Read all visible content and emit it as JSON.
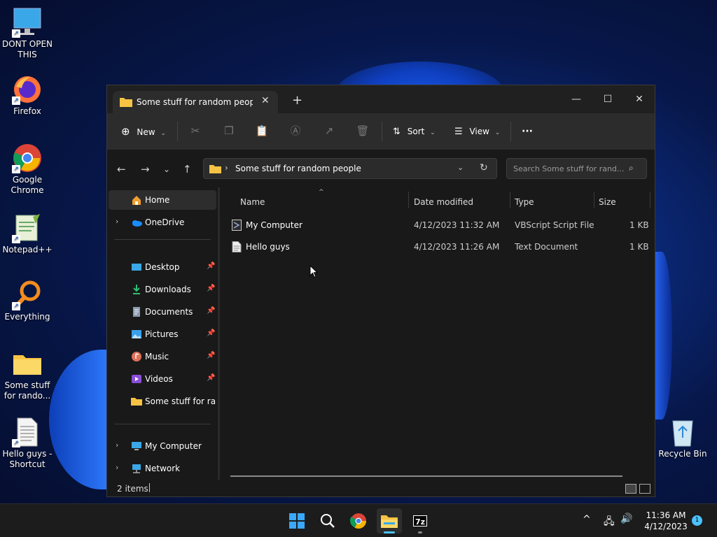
{
  "desktop": {
    "icons": [
      {
        "label": "DONT OPEN THIS",
        "icon": "monitor-icon"
      },
      {
        "label": "Firefox",
        "icon": "firefox-icon"
      },
      {
        "label": "Google Chrome",
        "icon": "chrome-icon"
      },
      {
        "label": "Notepad++",
        "icon": "notepadpp-icon"
      },
      {
        "label": "Everything",
        "icon": "search-magnifier-icon"
      },
      {
        "label": "Some stuff for rando...",
        "icon": "folder-icon"
      },
      {
        "label": "Hello guys - Shortcut",
        "icon": "text-document-icon"
      },
      {
        "label": "Recycle Bin",
        "icon": "recycle-bin-icon"
      }
    ]
  },
  "window": {
    "tab_title": "Some stuff for random people",
    "toolbar": {
      "new_label": "New",
      "sort_label": "Sort",
      "view_label": "View",
      "more_label": "···"
    },
    "address": {
      "path": "Some stuff for random people",
      "search_placeholder": "Search Some stuff for rand..."
    },
    "nav": {
      "home": "Home",
      "onedrive": "OneDrive",
      "quick": [
        {
          "label": "Desktop",
          "icon": "desktop-icon"
        },
        {
          "label": "Downloads",
          "icon": "downloads-icon"
        },
        {
          "label": "Documents",
          "icon": "documents-icon"
        },
        {
          "label": "Pictures",
          "icon": "pictures-icon"
        },
        {
          "label": "Music",
          "icon": "music-icon"
        },
        {
          "label": "Videos",
          "icon": "videos-icon"
        },
        {
          "label": "Some stuff for rand",
          "icon": "folder-icon"
        }
      ],
      "my_computer": "My Computer",
      "network": "Network"
    },
    "columns": {
      "name": "Name",
      "date": "Date modified",
      "type": "Type",
      "size": "Size"
    },
    "files": [
      {
        "name": "My Computer",
        "date": "4/12/2023 11:32 AM",
        "type": "VBScript Script File",
        "size": "1 KB",
        "icon": "vbscript-icon"
      },
      {
        "name": "Hello guys",
        "date": "4/12/2023 11:26 AM",
        "type": "Text Document",
        "size": "1 KB",
        "icon": "text-document-icon"
      }
    ],
    "status": {
      "items": "2 items"
    }
  },
  "taskbar": {
    "time": "11:36 AM",
    "date": "4/12/2023",
    "notifications": "1"
  },
  "colors": {
    "accent": "#0078d4",
    "folder": "#f6c344"
  }
}
